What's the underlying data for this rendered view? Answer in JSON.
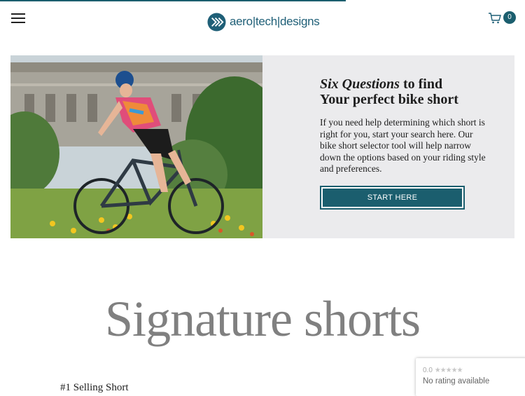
{
  "header": {
    "menu_icon": "hamburger-menu-icon",
    "logo_text": "aero|tech|designs",
    "cart_count": "0",
    "cart_icon": "shopping-cart-icon"
  },
  "hero": {
    "title_italic": "Six Questions",
    "title_rest": " to find",
    "title_line2": "Your perfect bike short",
    "body": "If you need help determining which short is right for you, start your search here. Our bike short selector tool will help narrow down the options based on your riding style and preferences.",
    "button_label": "START HERE",
    "photo": "cyclist-riding-road-bike"
  },
  "section": {
    "title": "Signature shorts",
    "product_label": "#1 Selling Short"
  },
  "rating_widget": {
    "score": "0.0",
    "stars": "★★★★★",
    "status": "No rating available"
  },
  "colors": {
    "brand": "#1b5e6e",
    "hero_bg": "#ebebed",
    "title_gray": "#808080"
  }
}
